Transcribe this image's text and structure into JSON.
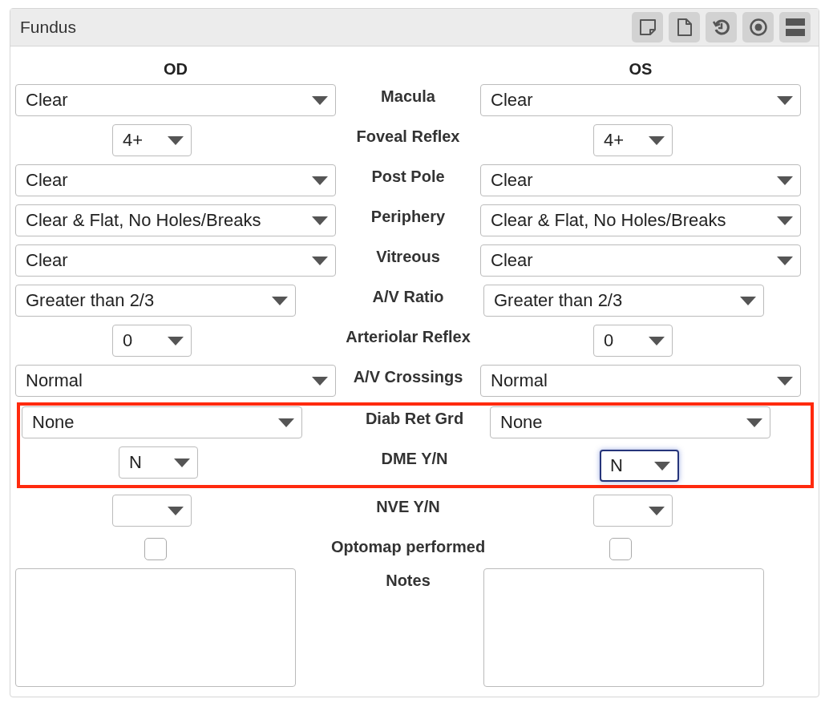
{
  "panel": {
    "title": "Fundus"
  },
  "columns": {
    "left": "OD",
    "right": "OS"
  },
  "rows": [
    {
      "label": "Macula",
      "kind": "select",
      "highlighted": false,
      "od": {
        "value": "Clear",
        "focused": false
      },
      "os": {
        "value": "Clear",
        "focused": false
      }
    },
    {
      "label": "Foveal Reflex",
      "kind": "select",
      "highlighted": false,
      "od": {
        "value": "4+",
        "focused": false
      },
      "os": {
        "value": "4+",
        "focused": false
      }
    },
    {
      "label": "Post Pole",
      "kind": "select",
      "highlighted": false,
      "od": {
        "value": "Clear",
        "focused": false
      },
      "os": {
        "value": "Clear",
        "focused": false
      }
    },
    {
      "label": "Periphery",
      "kind": "select",
      "highlighted": false,
      "od": {
        "value": "Clear & Flat, No Holes/Breaks",
        "focused": false
      },
      "os": {
        "value": "Clear & Flat, No Holes/Breaks",
        "focused": false
      }
    },
    {
      "label": "Vitreous",
      "kind": "select",
      "highlighted": false,
      "od": {
        "value": "Clear",
        "focused": false
      },
      "os": {
        "value": "Clear",
        "focused": false
      }
    },
    {
      "label": "A/V Ratio",
      "kind": "select",
      "highlighted": false,
      "od": {
        "value": "Greater than 2/3",
        "focused": false
      },
      "os": {
        "value": "Greater than 2/3",
        "focused": false
      }
    },
    {
      "label": "Arteriolar Reflex",
      "kind": "select",
      "highlighted": false,
      "od": {
        "value": "0",
        "focused": false
      },
      "os": {
        "value": "0",
        "focused": false
      }
    },
    {
      "label": "A/V Crossings",
      "kind": "select",
      "highlighted": false,
      "od": {
        "value": "Normal",
        "focused": false
      },
      "os": {
        "value": "Normal",
        "focused": false
      }
    },
    {
      "label": "Diab Ret Grd",
      "kind": "select",
      "highlighted": true,
      "od": {
        "value": "None",
        "focused": false
      },
      "os": {
        "value": "None",
        "focused": false
      }
    },
    {
      "label": "DME Y/N",
      "kind": "select",
      "highlighted": true,
      "od": {
        "value": "N",
        "focused": false
      },
      "os": {
        "value": "N",
        "focused": true
      }
    },
    {
      "label": "NVE Y/N",
      "kind": "select",
      "highlighted": false,
      "od": {
        "focused": false
      },
      "os": {
        "focused": false
      }
    },
    {
      "label": "Optomap performed",
      "kind": "checkbox",
      "highlighted": false,
      "od": {
        "checked": false
      },
      "os": {
        "checked": false
      }
    },
    {
      "label": "Notes",
      "kind": "textarea",
      "highlighted": false
    }
  ]
}
